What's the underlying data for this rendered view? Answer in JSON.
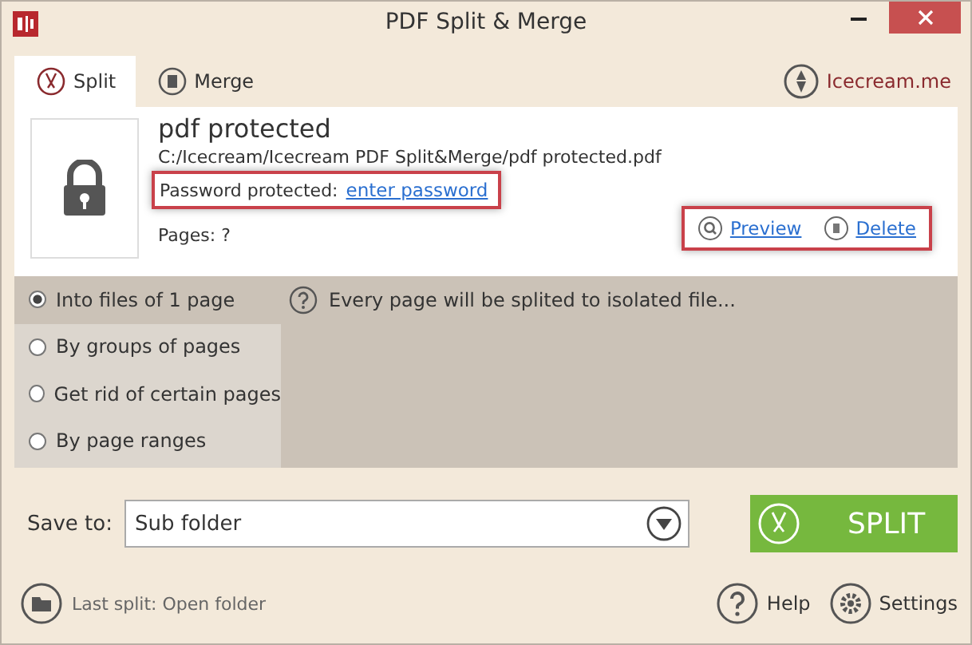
{
  "window": {
    "title": "PDF Split & Merge"
  },
  "tabs": [
    {
      "label": "Split",
      "selected": true
    },
    {
      "label": "Merge",
      "selected": false
    }
  ],
  "brand": {
    "label": "Icecream.me"
  },
  "file": {
    "name": "pdf protected",
    "path": "C:/Icecream/Icecream PDF Split&Merge/pdf protected.pdf",
    "password_label": "Password protected:",
    "password_link": "enter password",
    "pages": "Pages: ?",
    "preview": "Preview",
    "delete": "Delete"
  },
  "options": [
    {
      "label": "Into files of 1 page",
      "selected": true
    },
    {
      "label": "By groups of pages",
      "selected": false
    },
    {
      "label": "Get rid of certain pages",
      "selected": false
    },
    {
      "label": "By page ranges",
      "selected": false
    }
  ],
  "hint": "Every page will be splited to isolated file...",
  "save": {
    "label": "Save to:",
    "value": "Sub folder"
  },
  "split_button": "SPLIT",
  "footer": {
    "last_split": "Last split: Open folder",
    "help": "Help",
    "settings": "Settings"
  }
}
